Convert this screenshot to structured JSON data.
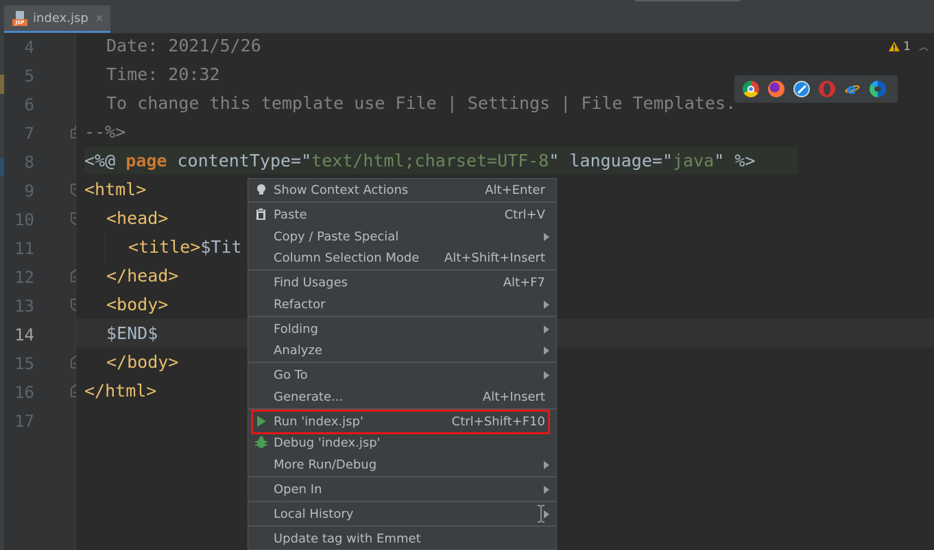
{
  "tab": {
    "filename": "index.jsp",
    "icon": "jsp-file-icon",
    "badge": "JSP"
  },
  "gutter": {
    "line_numbers": [
      "4",
      "5",
      "6",
      "7",
      "8",
      "9",
      "10",
      "11",
      "12",
      "13",
      "14",
      "15",
      "16",
      "17"
    ],
    "current_line": "14"
  },
  "code": {
    "l4": "Date: 2021/5/26",
    "l5": "Time: 20:32",
    "l6": "To change this template use File | Settings | File Templates.",
    "l7": "--%>",
    "l8_open": "<%@ ",
    "l8_kw": "page",
    "l8_attr1": " contentType=",
    "l8_q1": "\"",
    "l8_val1": "text/html;charset=UTF-8",
    "l8_q2": "\"",
    "l8_attr2": " language=",
    "l8_q3": "\"",
    "l8_val2": "java",
    "l8_q4": "\"",
    "l8_close": " %>",
    "l9": "<html>",
    "l10": "<head>",
    "l11_tag": "<title>",
    "l11_text": "$Tit",
    "l12": "</head>",
    "l13": "<body>",
    "l14": "$END$",
    "l15": "</body>",
    "l16": "</html>"
  },
  "inspection": {
    "warning_count": "1",
    "icon": "warning-icon"
  },
  "browsers": [
    "chrome-icon",
    "firefox-icon",
    "safari-icon",
    "opera-icon",
    "ie-icon",
    "edge-icon"
  ],
  "menu": {
    "show_context_actions": {
      "label": "Show Context Actions",
      "shortcut": "Alt+Enter"
    },
    "paste": {
      "label": "Paste",
      "shortcut": "Ctrl+V"
    },
    "copy_paste_special": {
      "label": "Copy / Paste Special"
    },
    "column_selection": {
      "label": "Column Selection Mode",
      "shortcut": "Alt+Shift+Insert"
    },
    "find_usages": {
      "label": "Find Usages",
      "shortcut": "Alt+F7"
    },
    "refactor": {
      "label": "Refactor"
    },
    "folding": {
      "label": "Folding"
    },
    "analyze": {
      "label": "Analyze"
    },
    "goto": {
      "label": "Go To"
    },
    "generate": {
      "label": "Generate...",
      "shortcut": "Alt+Insert"
    },
    "run": {
      "label": "Run 'index.jsp'",
      "shortcut": "Ctrl+Shift+F10"
    },
    "debug": {
      "label": "Debug 'index.jsp'"
    },
    "more_run_debug": {
      "label": "More Run/Debug"
    },
    "open_in": {
      "label": "Open In"
    },
    "local_history": {
      "label": "Local History"
    },
    "update_tag": {
      "label": "Update tag with Emmet"
    }
  },
  "colors": {
    "highlight_box": "#e31818",
    "run_icon": "#499c54",
    "keyword": "#cc7832",
    "tag": "#e8bf6a",
    "string": "#6a8759"
  }
}
